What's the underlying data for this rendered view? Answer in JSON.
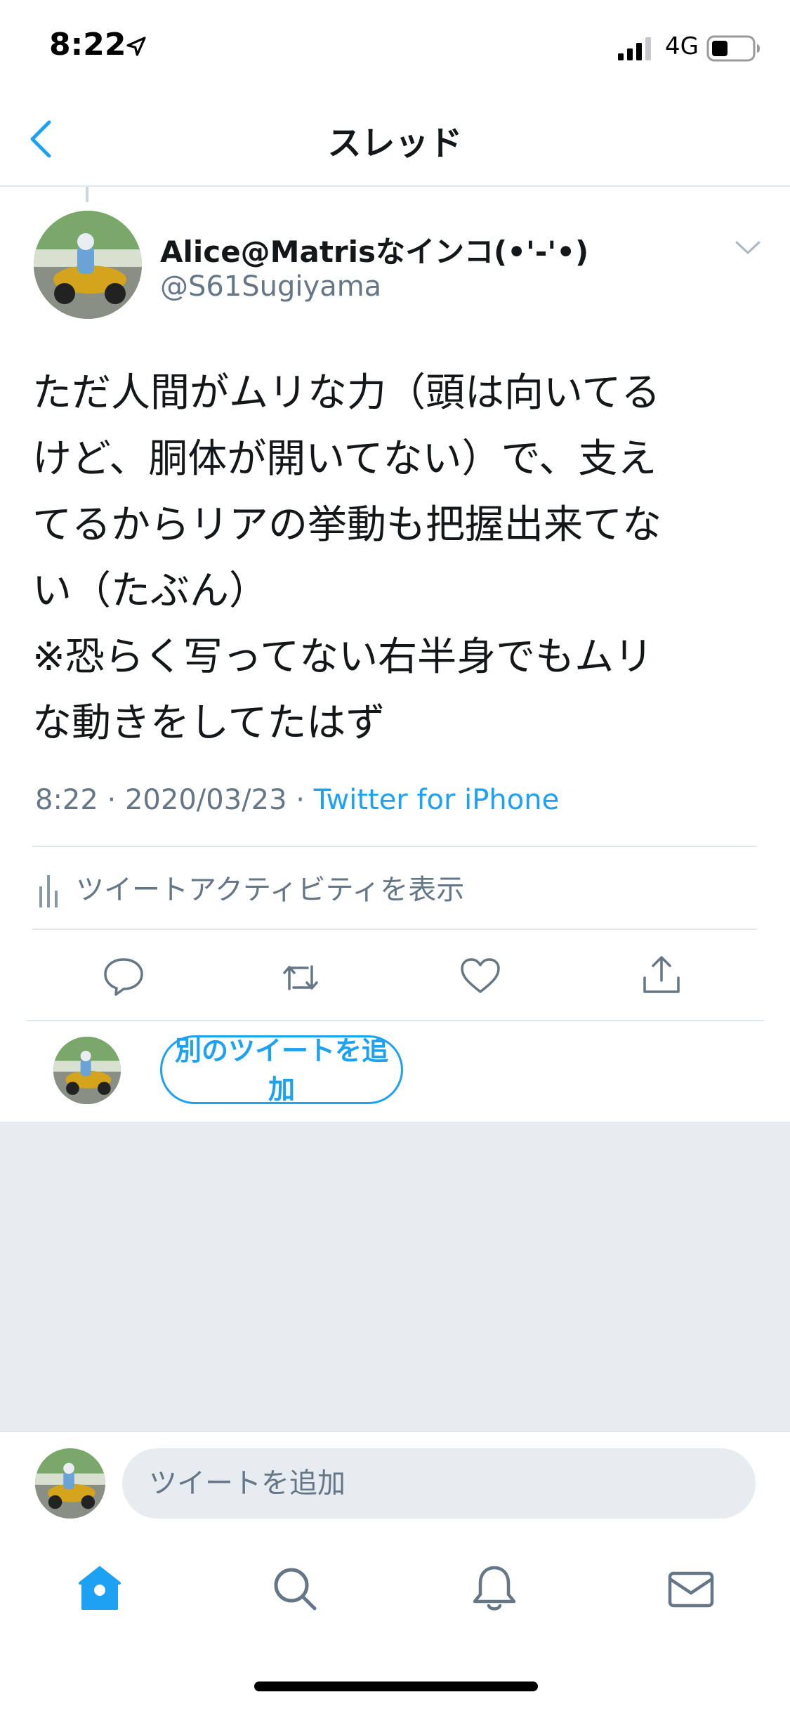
{
  "status_bar": {
    "time": "8:22",
    "network": "4G"
  },
  "nav": {
    "title": "スレッド"
  },
  "tweet": {
    "display_name": "Alice@Matrisなインコ(•'-'•)",
    "handle": "@S61Sugiyama",
    "text": "ただ人間がムリな力（頭は向いてる\nけど、胴体が開いてない）で、支え\nてるからリアの挙動も把握出来てな\nい（たぶん）\n※恐らく写ってない右半身でもムリ\nな動きをしてたはず",
    "time": "8:22",
    "date": "2020/03/23",
    "separator": "·",
    "source": "Twitter for iPhone",
    "activity_label": "ツイートアクティビティを表示"
  },
  "thread": {
    "add_button_label": "別のツイートを追加"
  },
  "composer": {
    "placeholder": "ツイートを追加"
  },
  "tabs": [
    {
      "icon": "home-icon",
      "active": true
    },
    {
      "icon": "search-icon",
      "active": false
    },
    {
      "icon": "bell-icon",
      "active": false
    },
    {
      "icon": "mail-icon",
      "active": false
    }
  ],
  "colors": {
    "accent": "#1da1f2",
    "secondary_text": "#657786",
    "icon_gray": "#657786",
    "background_gray": "#e6ecf0"
  }
}
